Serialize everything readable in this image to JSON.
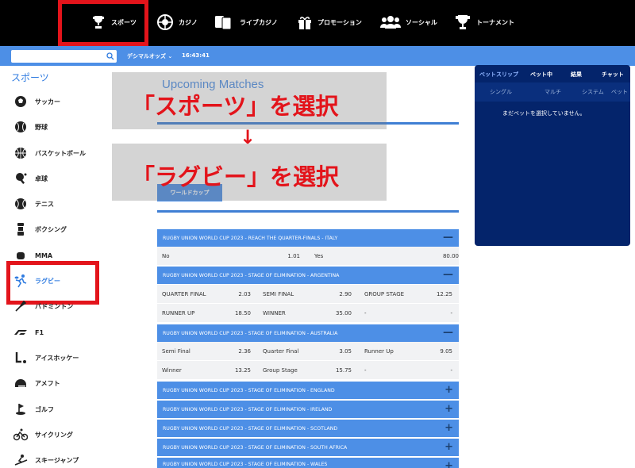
{
  "topnav": {
    "items": [
      {
        "label": "スポーツ",
        "icon": "trophy-icon"
      },
      {
        "label": "カジノ",
        "icon": "roulette-icon"
      },
      {
        "label": "ライブカジノ",
        "icon": "cards-icon"
      },
      {
        "label": "プロモーション",
        "icon": "gift-icon"
      },
      {
        "label": "ソーシャル",
        "icon": "users-icon"
      },
      {
        "label": "トーナメント",
        "icon": "cup-icon"
      }
    ],
    "highlight_color": "#e3141b"
  },
  "subbar": {
    "search_placeholder": "",
    "odds_format": "デシマルオッズ ⌄",
    "clock": "16:43:41",
    "color": "#4d8fe6"
  },
  "sidebar": {
    "title": "スポーツ",
    "items": [
      {
        "label": "サッカー",
        "icon": "soccer-ball-icon"
      },
      {
        "label": "野球",
        "icon": "baseball-icon"
      },
      {
        "label": "バスケットボール",
        "icon": "basketball-icon"
      },
      {
        "label": "卓球",
        "icon": "table-tennis-icon"
      },
      {
        "label": "テニス",
        "icon": "tennis-ball-icon"
      },
      {
        "label": "ボクシング",
        "icon": "boxing-icon"
      },
      {
        "label": "MMA",
        "icon": "mma-icon"
      },
      {
        "label": "ラグビー",
        "icon": "rugby-player-icon"
      },
      {
        "label": "バドミントン",
        "icon": "badminton-icon"
      },
      {
        "label": "F1",
        "icon": "f1-icon"
      },
      {
        "label": "アイスホッケー",
        "icon": "hockey-icon"
      },
      {
        "label": "アメフト",
        "icon": "american-football-icon"
      },
      {
        "label": "ゴルフ",
        "icon": "golf-icon"
      },
      {
        "label": "サイクリング",
        "icon": "cycling-icon"
      },
      {
        "label": "スキージャンプ",
        "icon": "ski-jump-icon"
      }
    ]
  },
  "main": {
    "upcoming_title": "Upcoming Matches",
    "world_cup_button": "ワールドカップ",
    "overlay": {
      "step1": "「スポーツ」を選択",
      "arrow": "↓",
      "step2": "「ラグビー」を選択"
    },
    "markets": [
      {
        "title": "RUGBY UNION WORLD CUP 2023 - REACH THE QUARTER-FINALS - ITALY",
        "toggle": "—",
        "rows": [
          [
            {
              "label": "No",
              "value": "1.01"
            },
            {
              "label": "Yes",
              "value": "80.00"
            }
          ]
        ]
      },
      {
        "title": "RUGBY UNION WORLD CUP 2023 - STAGE OF ELIMINATION - ARGENTINA",
        "toggle": "—",
        "rows": [
          [
            {
              "label": "QUARTER FINAL",
              "value": "2.03"
            },
            {
              "label": "SEMI FINAL",
              "value": "2.90"
            },
            {
              "label": "GROUP STAGE",
              "value": "12.25"
            }
          ],
          [
            {
              "label": "RUNNER UP",
              "value": "18.50"
            },
            {
              "label": "WINNER",
              "value": "35.00"
            },
            {
              "label": "-",
              "value": "-"
            }
          ]
        ]
      },
      {
        "title": "RUGBY UNION WORLD CUP 2023 - STAGE OF ELIMINATION - AUSTRALIA",
        "toggle": "—",
        "rows": [
          [
            {
              "label": "Semi Final",
              "value": "2.36"
            },
            {
              "label": "Quarter Final",
              "value": "3.05"
            },
            {
              "label": "Runner Up",
              "value": "9.05"
            }
          ],
          [
            {
              "label": "Winner",
              "value": "13.25"
            },
            {
              "label": "Group Stage",
              "value": "15.75"
            },
            {
              "label": "-",
              "value": "-"
            }
          ]
        ]
      },
      {
        "title": "RUGBY UNION WORLD CUP 2023 - STAGE OF ELIMINATION - ENGLAND",
        "toggle": "+",
        "rows": []
      },
      {
        "title": "RUGBY UNION WORLD CUP 2023 - STAGE OF ELIMINATION - IRELAND",
        "toggle": "+",
        "rows": []
      },
      {
        "title": "RUGBY UNION WORLD CUP 2023 - STAGE OF ELIMINATION - SCOTLAND",
        "toggle": "+",
        "rows": []
      },
      {
        "title": "RUGBY UNION WORLD CUP 2023 - STAGE OF ELIMINATION - SOUTH AFRICA",
        "toggle": "+",
        "rows": []
      },
      {
        "title": "RUGBY UNION WORLD CUP 2023 - STAGE OF ELIMINATION - WALES",
        "toggle": "+",
        "rows": []
      }
    ]
  },
  "betslip": {
    "tabs": [
      "ベットスリップ",
      "ベット中",
      "結果",
      "チャット"
    ],
    "subtabs": [
      "シングル",
      "マルチ",
      "システム",
      "ベット"
    ],
    "empty_message": "まだベットを選択していません。",
    "background": "#04246b"
  }
}
